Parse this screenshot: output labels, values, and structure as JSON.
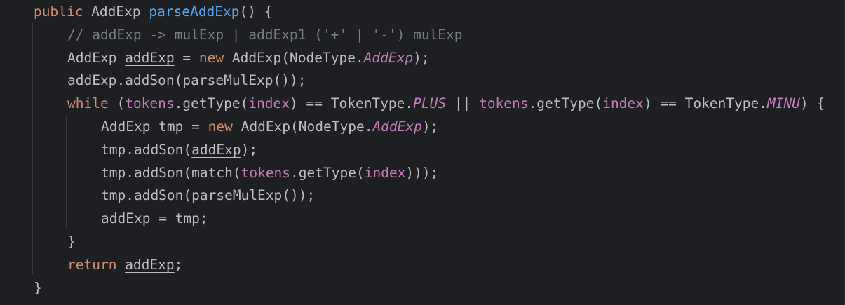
{
  "editor": {
    "theme": {
      "background": "#1e1f22",
      "text": "#bcbec4",
      "keyword": "#cf8e6d",
      "function": "#56a8f5",
      "comment": "#7a7e85",
      "field": "#c77dbb"
    },
    "lines": [
      {
        "indent": 0,
        "tokens": [
          {
            "text": "public ",
            "cls": "kw"
          },
          {
            "text": "AddExp ",
            "cls": "t"
          },
          {
            "text": "parseAddExp",
            "cls": "fn"
          },
          {
            "text": "() {",
            "cls": "t"
          }
        ]
      },
      {
        "indent": 1,
        "tokens": [
          {
            "text": "// addExp -> mulExp | addExp1 ('+' | '-') mulExp",
            "cls": "cm"
          }
        ]
      },
      {
        "indent": 1,
        "tokens": [
          {
            "text": "AddExp ",
            "cls": "t"
          },
          {
            "text": "addExp",
            "cls": "t ul"
          },
          {
            "text": " = ",
            "cls": "t"
          },
          {
            "text": "new ",
            "cls": "kw"
          },
          {
            "text": "AddExp(NodeType.",
            "cls": "t"
          },
          {
            "text": "AddExp",
            "cls": "const"
          },
          {
            "text": ");",
            "cls": "t"
          }
        ]
      },
      {
        "indent": 1,
        "tokens": [
          {
            "text": "addExp",
            "cls": "t ul"
          },
          {
            "text": ".addSon(parseMulExp());",
            "cls": "t"
          }
        ]
      },
      {
        "indent": 1,
        "tokens": [
          {
            "text": "while ",
            "cls": "kw"
          },
          {
            "text": "(",
            "cls": "t"
          },
          {
            "text": "tokens",
            "cls": "field"
          },
          {
            "text": ".getType(",
            "cls": "t"
          },
          {
            "text": "index",
            "cls": "field"
          },
          {
            "text": ") == TokenType.",
            "cls": "t"
          },
          {
            "text": "PLUS",
            "cls": "const"
          },
          {
            "text": " || ",
            "cls": "t"
          },
          {
            "text": "tokens",
            "cls": "field"
          },
          {
            "text": ".getType(",
            "cls": "t"
          },
          {
            "text": "index",
            "cls": "field"
          },
          {
            "text": ") == TokenType.",
            "cls": "t"
          },
          {
            "text": "MINU",
            "cls": "const"
          },
          {
            "text": ") {",
            "cls": "t"
          }
        ]
      },
      {
        "indent": 2,
        "tokens": [
          {
            "text": "AddExp tmp = ",
            "cls": "t"
          },
          {
            "text": "new ",
            "cls": "kw"
          },
          {
            "text": "AddExp(NodeType.",
            "cls": "t"
          },
          {
            "text": "AddExp",
            "cls": "const"
          },
          {
            "text": ");",
            "cls": "t"
          }
        ]
      },
      {
        "indent": 2,
        "tokens": [
          {
            "text": "tmp.addSon(",
            "cls": "t"
          },
          {
            "text": "addExp",
            "cls": "t ul"
          },
          {
            "text": ");",
            "cls": "t"
          }
        ]
      },
      {
        "indent": 2,
        "tokens": [
          {
            "text": "tmp.addSon(match(",
            "cls": "t"
          },
          {
            "text": "tokens",
            "cls": "field"
          },
          {
            "text": ".getType(",
            "cls": "t"
          },
          {
            "text": "index",
            "cls": "field"
          },
          {
            "text": ")));",
            "cls": "t"
          }
        ]
      },
      {
        "indent": 2,
        "tokens": [
          {
            "text": "tmp.addSon(parseMulExp());",
            "cls": "t"
          }
        ]
      },
      {
        "indent": 2,
        "tokens": [
          {
            "text": "addExp",
            "cls": "t ul"
          },
          {
            "text": " = tmp;",
            "cls": "t"
          }
        ]
      },
      {
        "indent": 1,
        "tokens": [
          {
            "text": "}",
            "cls": "t"
          }
        ]
      },
      {
        "indent": 1,
        "tokens": [
          {
            "text": "return ",
            "cls": "kw"
          },
          {
            "text": "addExp",
            "cls": "t ul"
          },
          {
            "text": ";",
            "cls": "t"
          }
        ]
      },
      {
        "indent": 0,
        "tokens": [
          {
            "text": "}",
            "cls": "t"
          }
        ]
      }
    ]
  }
}
